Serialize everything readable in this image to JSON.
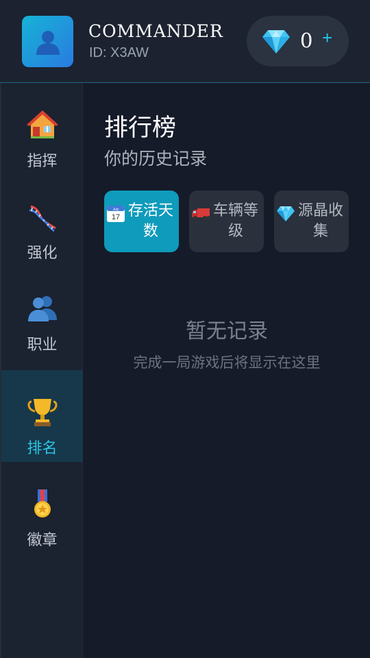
{
  "header": {
    "name": "COMMANDER",
    "id_label": "ID: X3AW",
    "gems": "0",
    "add_label": "+"
  },
  "sidebar": {
    "items": [
      {
        "label": "指挥",
        "icon": "house-icon",
        "active": false
      },
      {
        "label": "强化",
        "icon": "dna-icon",
        "active": false
      },
      {
        "label": "职业",
        "icon": "people-icon",
        "active": false
      },
      {
        "label": "排名",
        "icon": "trophy-icon",
        "active": true
      },
      {
        "label": "徽章",
        "icon": "medal-icon",
        "active": false
      }
    ]
  },
  "main": {
    "title": "排行榜",
    "subtitle": "你的历史记录",
    "tabs": [
      {
        "label": "存活天数",
        "icon": "calendar-icon",
        "calendar_month": "July",
        "calendar_day": "17",
        "active": true
      },
      {
        "label": "车辆等级",
        "icon": "truck-icon",
        "active": false
      },
      {
        "label": "源晶收集",
        "icon": "gem-icon",
        "active": false
      }
    ],
    "empty_title": "暂无记录",
    "empty_subtitle": "完成一局游戏后将显示在这里"
  },
  "colors": {
    "accent": "#22c5e6",
    "active_tab": "#0f9bbb",
    "active_nav": "#16384a",
    "background": "#151b29"
  }
}
